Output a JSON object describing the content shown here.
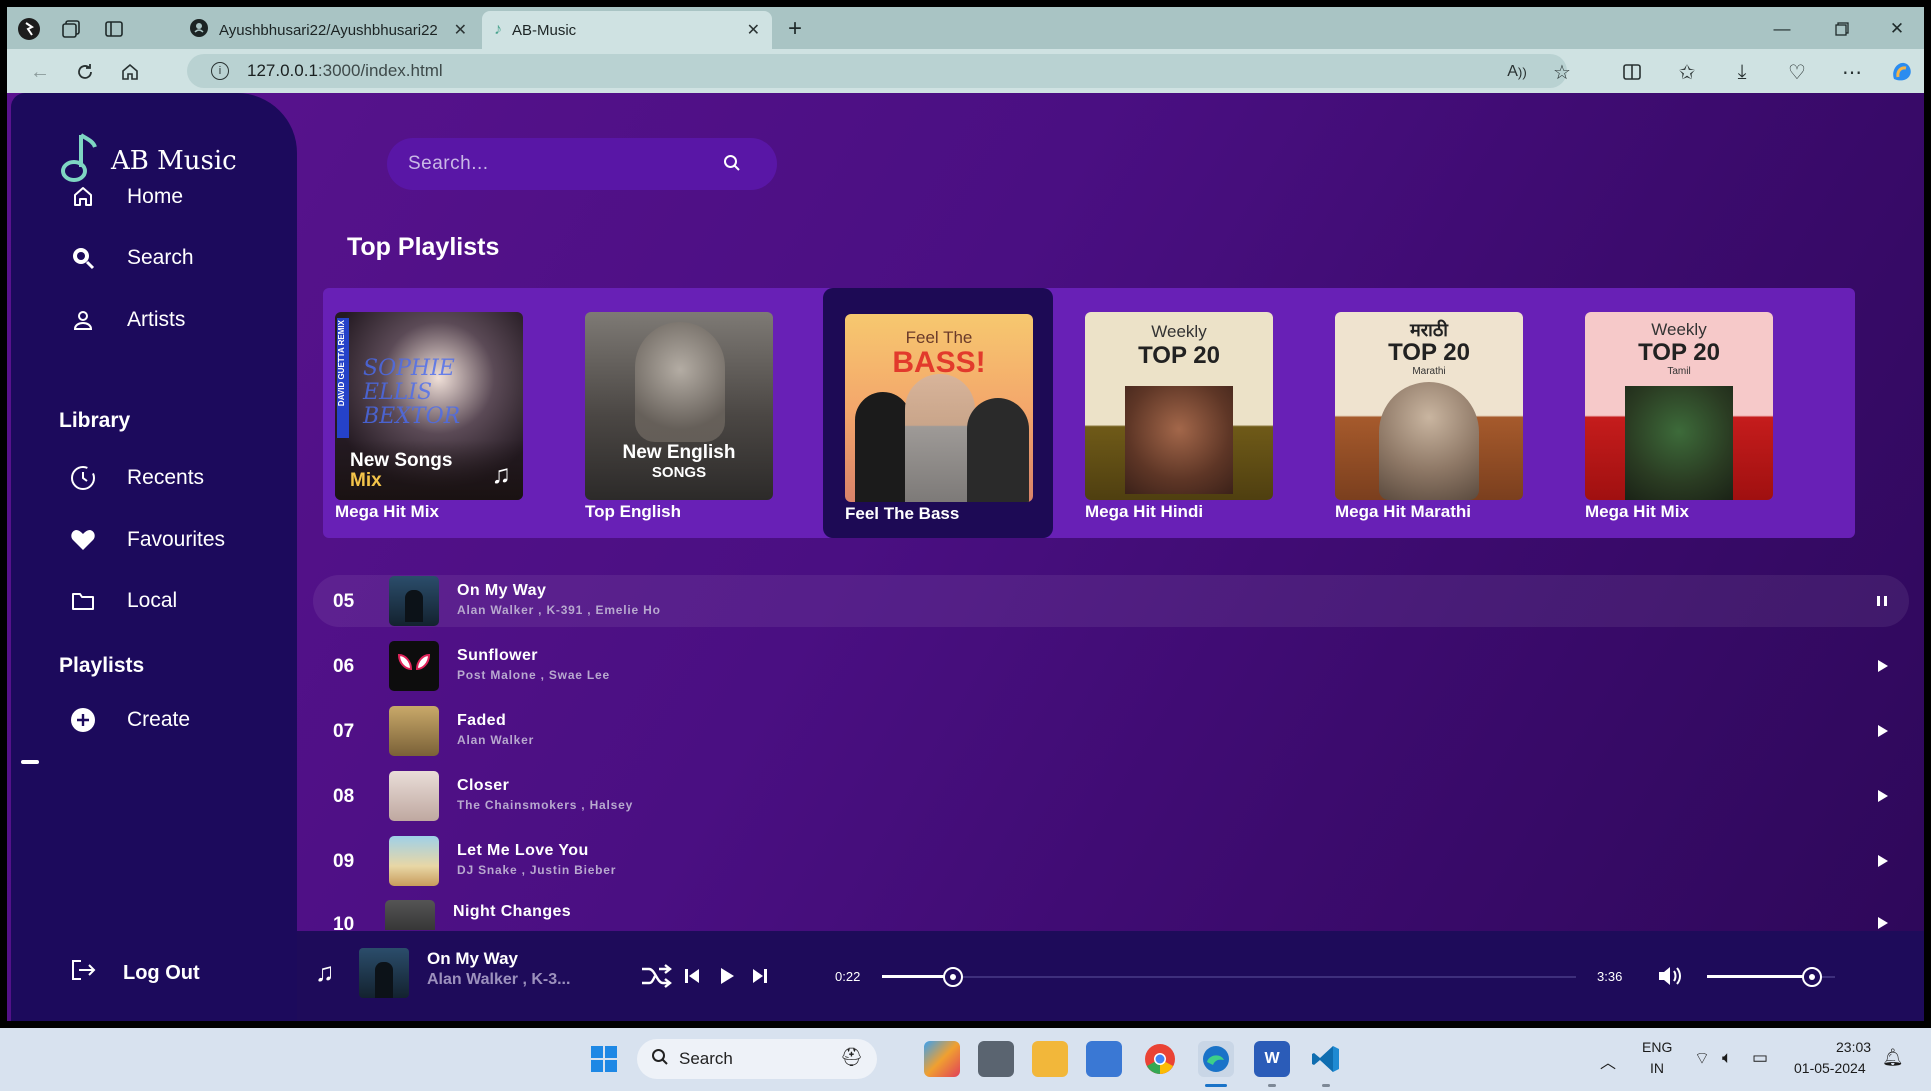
{
  "browser": {
    "tabs": [
      {
        "title": "Ayushbhusari22/Ayushbhusari22",
        "icon": "github-icon"
      },
      {
        "title": "AB-Music",
        "icon": "music-note-icon"
      }
    ],
    "url_host": "127.0.0.1",
    "url_path": ":3000/index.html"
  },
  "app": {
    "brand": "AB Music",
    "nav": [
      {
        "label": "Home",
        "icon": "home-icon"
      },
      {
        "label": "Search",
        "icon": "search-icon"
      },
      {
        "label": "Artists",
        "icon": "user-icon"
      }
    ],
    "library_heading": "Library",
    "library": [
      {
        "label": "Recents",
        "icon": "clock-icon"
      },
      {
        "label": "Favourites",
        "icon": "heart-icon"
      },
      {
        "label": "Local",
        "icon": "folder-icon"
      }
    ],
    "playlists_heading": "Playlists",
    "create_label": "Create",
    "logout_label": "Log Out",
    "search_placeholder": "Search...",
    "top_playlists_title": "Top Playlists",
    "playlists": [
      {
        "name": "Mega Hit Mix",
        "cover_line1": "New Songs",
        "cover_line2": "Mix",
        "cover_side": "DAVID GUETTA REMIX",
        "cover_art": "SOPHIE ELLIS BEXTOR"
      },
      {
        "name": "Top English",
        "cover_line1": "New English",
        "cover_line2": "SONGS"
      },
      {
        "name": "Feel The Bass",
        "cover_line1": "Feel The",
        "cover_line2": "BASS!"
      },
      {
        "name": "Mega Hit Hindi",
        "cover_line1": "Weekly",
        "cover_line2": "TOP 20"
      },
      {
        "name": "Mega Hit Marathi",
        "cover_line1": "मराठी",
        "cover_line2": "TOP 20",
        "cover_line3": "Marathi"
      },
      {
        "name": "Mega Hit Mix",
        "cover_line1": "Weekly",
        "cover_line2": "TOP 20",
        "cover_line3": "Tamil"
      }
    ],
    "songs": [
      {
        "num": "05",
        "title": "On My Way",
        "artist": "Alan Walker , K-391 , Emelie Ho",
        "state": "playing"
      },
      {
        "num": "06",
        "title": "Sunflower",
        "artist": "Post Malone , Swae Lee",
        "state": "paused"
      },
      {
        "num": "07",
        "title": "Faded",
        "artist": "Alan Walker",
        "state": "paused"
      },
      {
        "num": "08",
        "title": "Closer",
        "artist": "The Chainsmokers , Halsey",
        "state": "paused"
      },
      {
        "num": "09",
        "title": "Let Me Love You",
        "artist": "DJ Snake , Justin Bieber",
        "state": "paused"
      },
      {
        "num": "10",
        "title": "Night Changes",
        "artist": "",
        "state": "paused"
      }
    ],
    "player": {
      "title": "On My Way",
      "artist": "Alan Walker , K-3...",
      "current_time": "0:22",
      "duration": "3:36",
      "progress": 0.102,
      "volume": 0.82
    }
  },
  "taskbar": {
    "search_label": "Search",
    "language": "ENG",
    "region": "IN",
    "time": "23:03",
    "date": "01-05-2024"
  },
  "colors": {
    "accent_teal": "#7fd6c3",
    "sidebar_bg": "#1c0a5c",
    "main_bg": "#4a0f82",
    "strip_bg": "#6820b6"
  }
}
